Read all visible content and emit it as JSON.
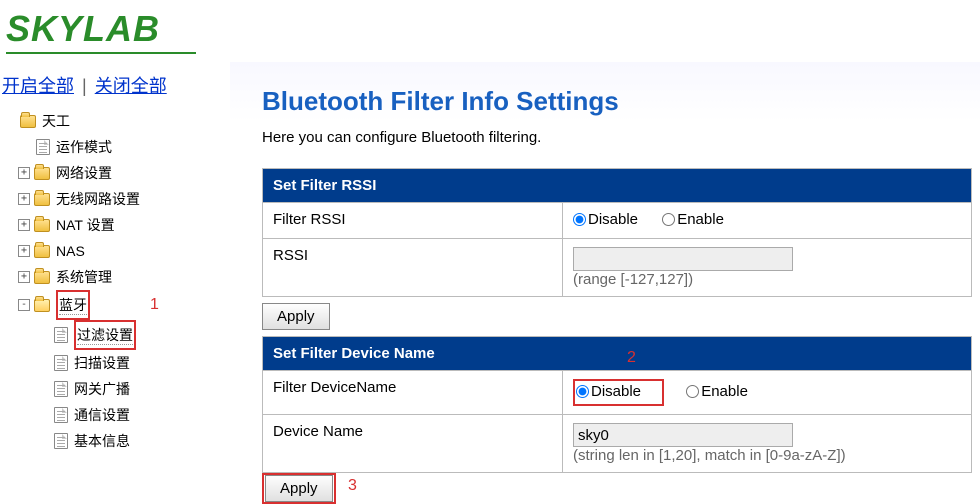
{
  "logo": "SKYLAB",
  "links": {
    "open_all": "开启全部",
    "close_all": "关闭全部"
  },
  "tree": {
    "root": "天工",
    "items": [
      "运作模式",
      "网络设置",
      "无线网路设置",
      "NAT 设置",
      "NAS",
      "系统管理",
      "蓝牙"
    ],
    "bluetooth_children": [
      "过滤设置",
      "扫描设置",
      "网关广播",
      "通信设置",
      "基本信息"
    ]
  },
  "annotations": {
    "n1": "1",
    "n2": "2",
    "n3": "3"
  },
  "page": {
    "title": "Bluetooth Filter Info Settings",
    "desc": "Here you can configure Bluetooth filtering."
  },
  "rssi_section": {
    "header": "Set Filter RSSI",
    "row1_label": "Filter RSSI",
    "disable": "Disable",
    "enable": "Enable",
    "row2_label": "RSSI",
    "rssi_value": "",
    "hint": "(range [-127,127])",
    "apply": "Apply"
  },
  "devname_section": {
    "header": "Set Filter Device Name",
    "row1_label": "Filter DeviceName",
    "disable": "Disable",
    "enable": "Enable",
    "row2_label": "Device Name",
    "devname_value": "sky0",
    "hint": "(string len in [1,20], match in [0-9a-zA-Z])",
    "apply": "Apply"
  }
}
